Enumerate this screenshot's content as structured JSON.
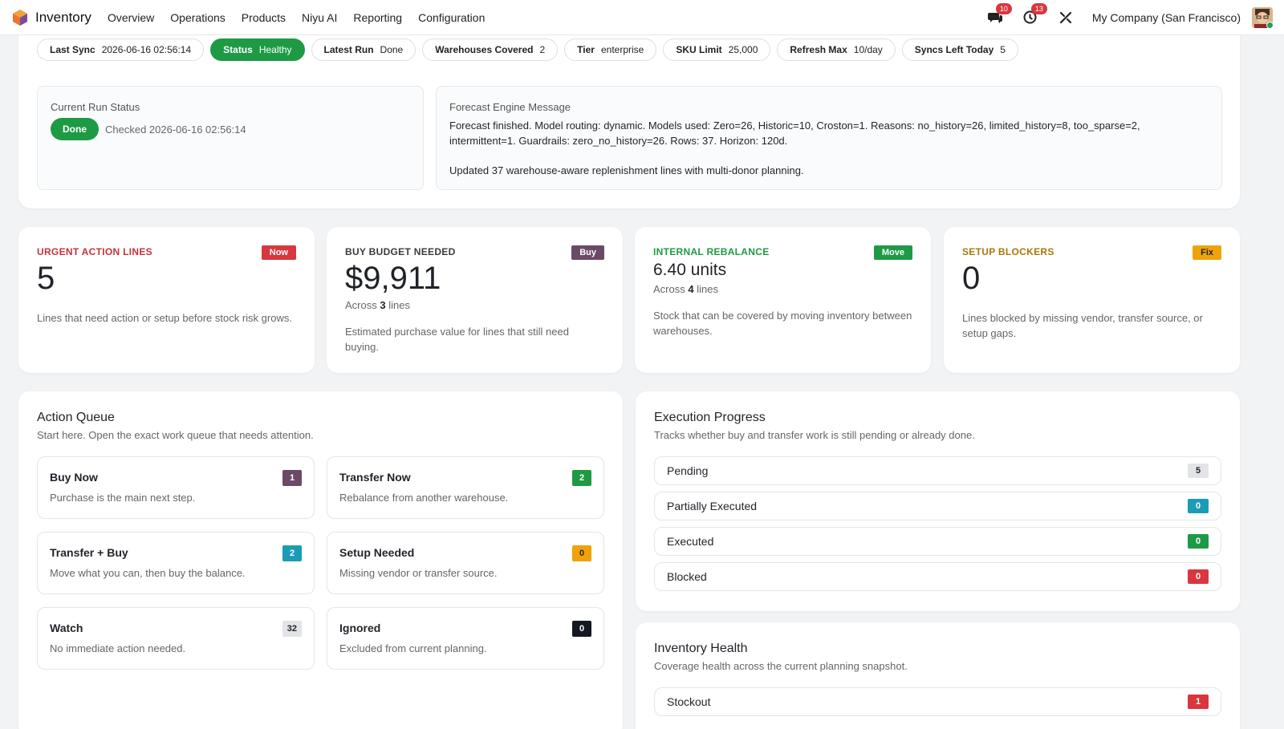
{
  "navbar": {
    "app_name": "Inventory",
    "menu": [
      "Overview",
      "Operations",
      "Products",
      "Niyu AI",
      "Reporting",
      "Configuration"
    ],
    "messages_count": "10",
    "activities_count": "13",
    "company": "My Company (San Francisco)",
    "icons": [
      "app-logo-icon",
      "chat-icon",
      "clock-icon",
      "tools-icon",
      "avatar"
    ]
  },
  "status_pills": [
    {
      "label": "Last Sync",
      "value": "2026-06-16 02:56:14"
    },
    {
      "label": "Status",
      "value": "Healthy"
    },
    {
      "label": "Latest Run",
      "value": "Done"
    },
    {
      "label": "Warehouses Covered",
      "value": "2"
    },
    {
      "label": "Tier",
      "value": "enterprise"
    },
    {
      "label": "SKU Limit",
      "value": "25,000"
    },
    {
      "label": "Refresh Max",
      "value": "10/day"
    },
    {
      "label": "Syncs Left Today",
      "value": "5"
    }
  ],
  "run_status": {
    "label": "Current Run Status",
    "badge": "Done",
    "checked": "Checked 2026-06-16 02:56:14"
  },
  "forecast": {
    "label": "Forecast Engine Message",
    "message": "Forecast finished. Model routing: dynamic. Models used: Zero=26, Historic=10, Croston=1. Reasons: no_history=26, limited_history=8, too_sparse=2, intermittent=1. Guardrails: zero_no_history=26. Rows: 37. Horizon: 120d.",
    "message2": "Updated 37 warehouse-aware replenishment lines with multi-donor planning."
  },
  "kpis": {
    "urgent": {
      "title": "URGENT ACTION LINES",
      "tag": "Now",
      "value": "5",
      "desc": "Lines that need action or setup before stock risk grows."
    },
    "buy": {
      "title": "BUY BUDGET NEEDED",
      "tag": "Buy",
      "value": "$9,911",
      "across_prefix": "Across",
      "across_count": "3",
      "across_suffix": "lines",
      "desc": "Estimated purchase value for lines that still need buying."
    },
    "rebalance": {
      "title": "INTERNAL REBALANCE",
      "tag": "Move",
      "value": "6.40 units",
      "across_prefix": "Across",
      "across_count": "4",
      "across_suffix": "lines",
      "desc": "Stock that can be covered by moving inventory between warehouses."
    },
    "setup": {
      "title": "SETUP BLOCKERS",
      "tag": "Fix",
      "value": "0",
      "desc": "Lines blocked by missing vendor, transfer source, or setup gaps."
    }
  },
  "colors": {
    "urgent": "#c7323a",
    "buy_title": "#3b3b3b",
    "buy_tag": "#6b4a68",
    "move": "#1e9a45",
    "fix_title": "#a9770a",
    "fix_tag": "#f0a20a",
    "info": "#1b9bb6",
    "danger": "#d9363e",
    "grey": "#e2e4e8",
    "dark": "#141820"
  },
  "action_queue": {
    "title": "Action Queue",
    "subtitle": "Start here. Open the exact work queue that needs attention.",
    "items": [
      {
        "name": "Buy Now",
        "desc": "Purchase is the main next step.",
        "count": "1"
      },
      {
        "name": "Transfer Now",
        "desc": "Rebalance from another warehouse.",
        "count": "2"
      },
      {
        "name": "Transfer + Buy",
        "desc": "Move what you can, then buy the balance.",
        "count": "2"
      },
      {
        "name": "Setup Needed",
        "desc": "Missing vendor or transfer source.",
        "count": "0"
      },
      {
        "name": "Watch",
        "desc": "No immediate action needed.",
        "count": "32"
      },
      {
        "name": "Ignored",
        "desc": "Excluded from current planning.",
        "count": "0"
      }
    ]
  },
  "execution": {
    "title": "Execution Progress",
    "subtitle": "Tracks whether buy and transfer work is still pending or already done.",
    "rows": [
      {
        "label": "Pending",
        "count": "5"
      },
      {
        "label": "Partially Executed",
        "count": "0"
      },
      {
        "label": "Executed",
        "count": "0"
      },
      {
        "label": "Blocked",
        "count": "0"
      }
    ]
  },
  "health": {
    "title": "Inventory Health",
    "subtitle": "Coverage health across the current planning snapshot.",
    "rows": [
      {
        "label": "Stockout",
        "count": "1"
      }
    ]
  }
}
